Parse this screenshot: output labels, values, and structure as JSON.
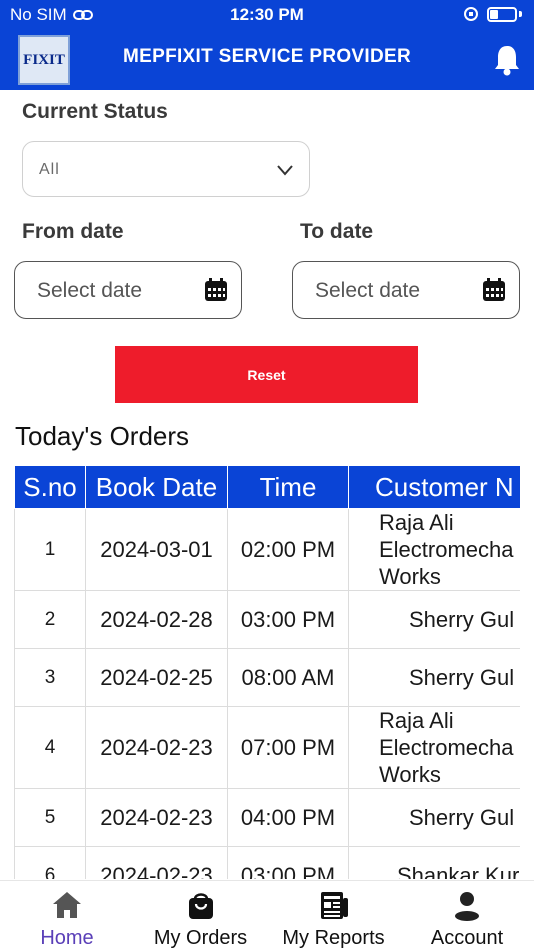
{
  "status_bar": {
    "carrier": "No SIM",
    "time": "12:30 PM"
  },
  "header": {
    "title": "MEPFIXIT SERVICE PROVIDER",
    "logo_text": "FIXIT"
  },
  "filters": {
    "status_label": "Current Status",
    "status_value": "All",
    "from_label": "From date",
    "to_label": "To date",
    "from_placeholder": "Select date",
    "to_placeholder": "Select date",
    "reset_label": "Reset"
  },
  "orders": {
    "title": "Today's Orders",
    "columns": [
      "S.no",
      "Book Date",
      "Time",
      "Customer N"
    ],
    "rows": [
      {
        "sno": "1",
        "date": "2024-03-01",
        "time": "02:00 PM",
        "customer": "Raja Ali Electromecha Works"
      },
      {
        "sno": "2",
        "date": "2024-02-28",
        "time": "03:00 PM",
        "customer": "Sherry Gul"
      },
      {
        "sno": "3",
        "date": "2024-02-25",
        "time": "08:00 AM",
        "customer": "Sherry Gul"
      },
      {
        "sno": "4",
        "date": "2024-02-23",
        "time": "07:00 PM",
        "customer": "Raja Ali Electromecha Works"
      },
      {
        "sno": "5",
        "date": "2024-02-23",
        "time": "04:00 PM",
        "customer": "Sherry Gul"
      },
      {
        "sno": "6",
        "date": "2024-02-23",
        "time": "03:00 PM",
        "customer": "Shankar Kur"
      }
    ]
  },
  "nav": {
    "home": "Home",
    "orders": "My Orders",
    "reports": "My Reports",
    "account": "Account"
  },
  "colors": {
    "primary": "#0a44d6",
    "reset": "#ee1c2b",
    "active_nav": "#5a3fb8"
  }
}
